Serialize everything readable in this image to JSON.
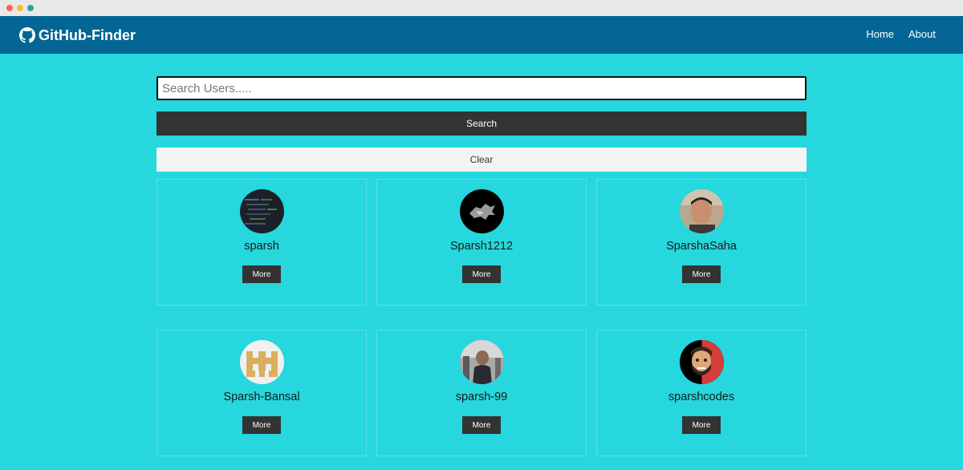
{
  "navbar": {
    "brand": "GitHub-Finder",
    "links": [
      "Home",
      "About"
    ]
  },
  "search": {
    "placeholder": "Search Users.....",
    "value": "",
    "search_label": "Search",
    "clear_label": "Clear"
  },
  "users": [
    {
      "login": "sparsh",
      "more_label": "More",
      "avatar": "dark-code-avatar"
    },
    {
      "login": "Sparsh1212",
      "more_label": "More",
      "avatar": "wolf-sigil-avatar"
    },
    {
      "login": "SparshaSaha",
      "more_label": "More",
      "avatar": "person-photo-avatar"
    },
    {
      "login": "Sparsh-Bansal",
      "more_label": "More",
      "avatar": "identicon-avatar"
    },
    {
      "login": "sparsh-99",
      "more_label": "More",
      "avatar": "street-photo-avatar"
    },
    {
      "login": "sparshcodes",
      "more_label": "More",
      "avatar": "bitmoji-avatar"
    }
  ],
  "colors": {
    "navbar": "#046694",
    "background": "#26d7dd",
    "dark_button": "#333333",
    "light_button": "#f4f4f4"
  }
}
